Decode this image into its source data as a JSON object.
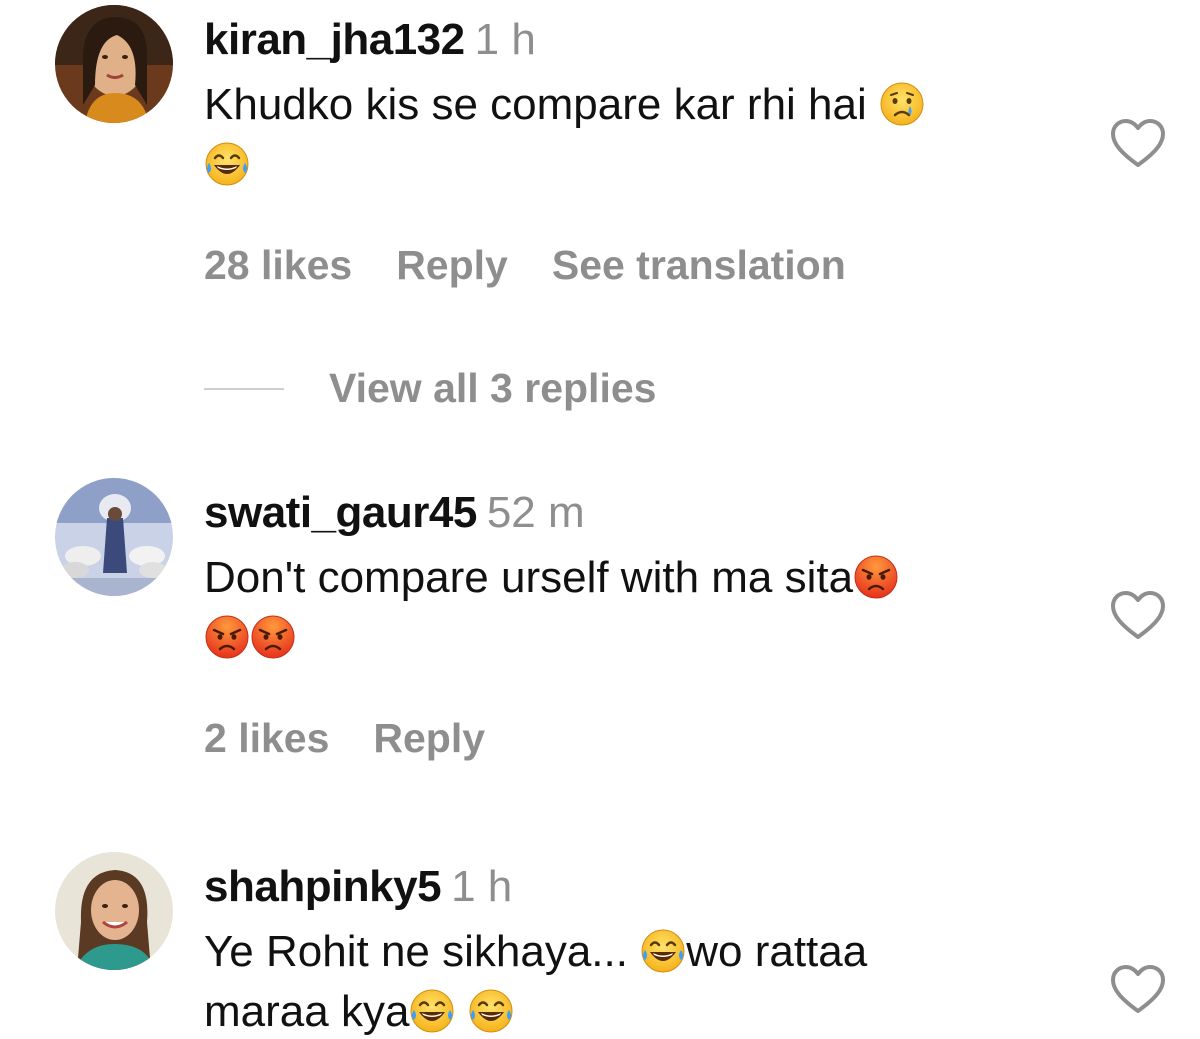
{
  "comments": [
    {
      "username": "kiran_jha132",
      "time": "1 h",
      "text_line1": "Khudko kis se compare kar rhi hai",
      "likes": "28 likes",
      "reply": "Reply",
      "translate": "See translation",
      "view_replies": "View all 3 replies",
      "avatar_icon": "woman-portrait-avatar",
      "emojis": [
        "crying-face-icon",
        "tears-of-joy-icon"
      ]
    },
    {
      "username": "swati_gaur45",
      "time": "52 m",
      "text_line1": "Don't compare urself with ma sita",
      "likes": "2 likes",
      "reply": "Reply",
      "avatar_icon": "krishna-cows-avatar",
      "emojis": [
        "angry-face-icon",
        "angry-face-icon",
        "angry-face-icon"
      ]
    },
    {
      "username": "shahpinky5",
      "time": "1 h",
      "text_line1a": "Ye Rohit ne sikhaya...",
      "text_line1b": "wo rattaa",
      "text_line2": "maraa kya",
      "avatar_icon": "woman-smiling-avatar",
      "emojis": [
        "tears-of-joy-icon",
        "tears-of-joy-icon",
        "tears-of-joy-icon"
      ]
    }
  ],
  "colors": {
    "primary_text": "#111111",
    "secondary_text": "#8e8e8e",
    "divider": "#cfcfcf",
    "background": "#ffffff"
  }
}
